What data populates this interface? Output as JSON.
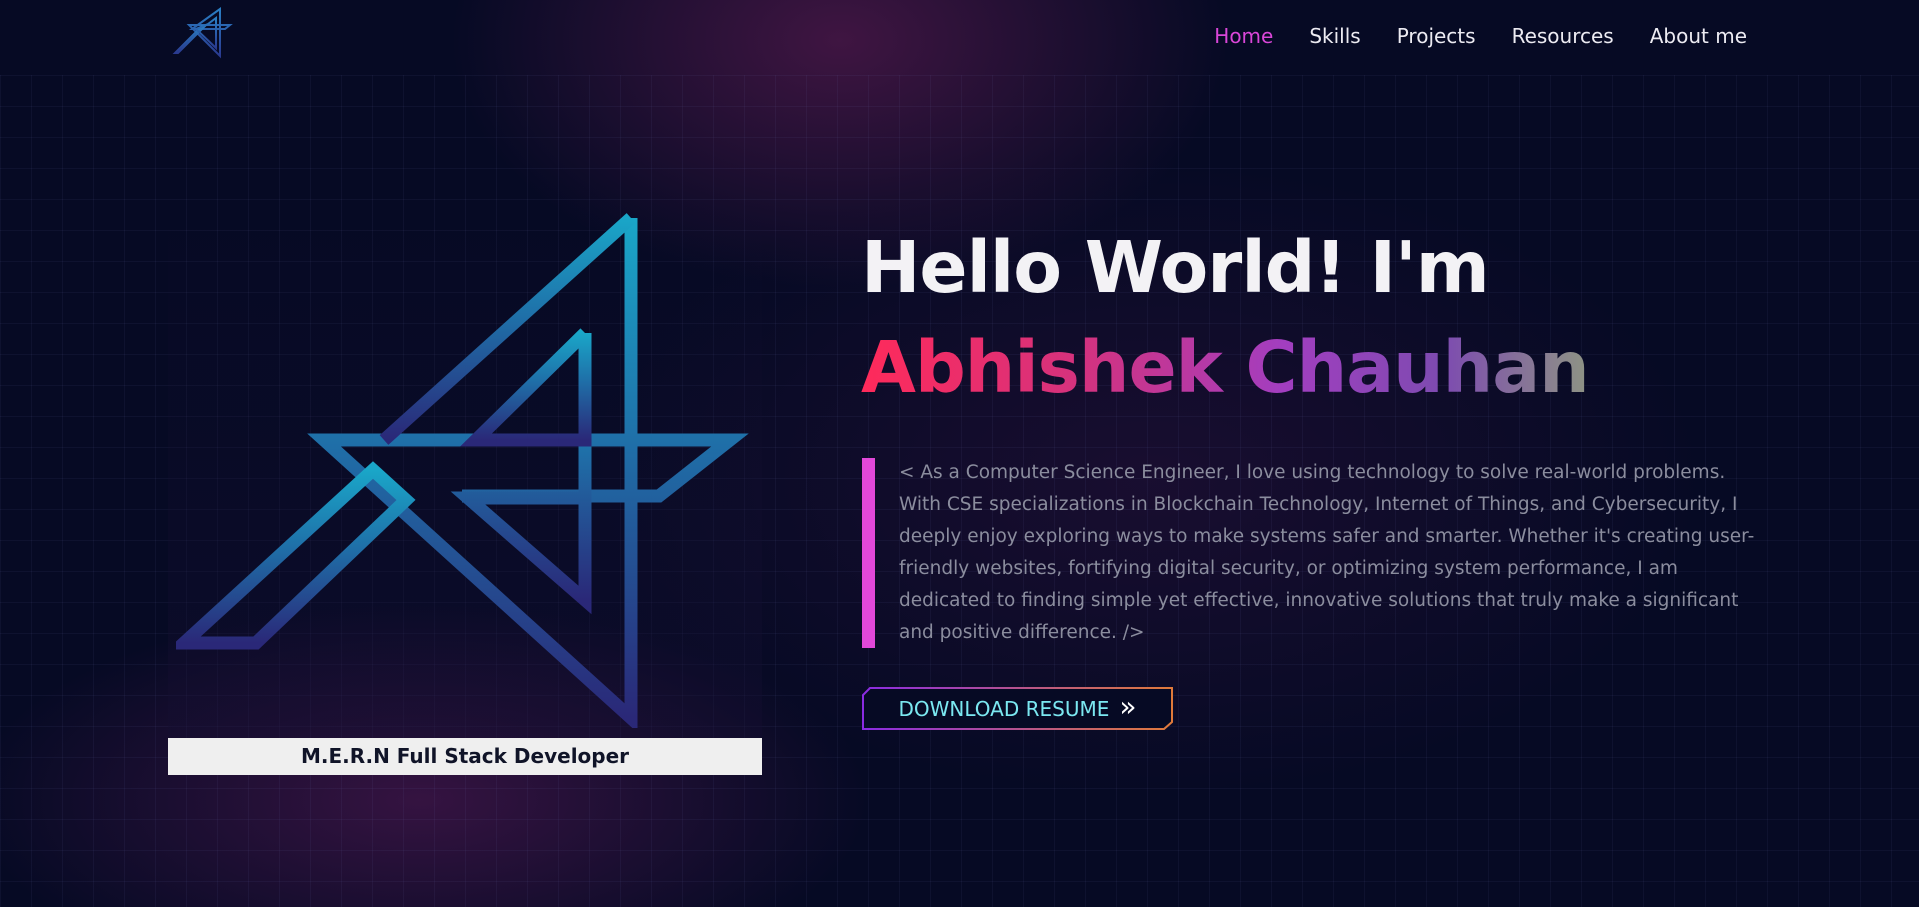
{
  "nav": {
    "logo_label": "A",
    "links": [
      {
        "label": "Home",
        "active": true
      },
      {
        "label": "Skills",
        "active": false
      },
      {
        "label": "Projects",
        "active": false
      },
      {
        "label": "Resources",
        "active": false
      },
      {
        "label": "About me",
        "active": false
      }
    ]
  },
  "hero": {
    "greeting": "Hello World! I'm",
    "name": "Abhishek Chauhan",
    "role": "M.E.R.N Full Stack Developer",
    "bio": "< As a Computer Science Engineer, I love using technology to solve real-world problems. With CSE specializations in Blockchain Technology, Internet of Things, and Cybersecurity, I deeply enjoy exploring ways to make systems safer and smarter. Whether it's creating user-friendly websites, fortifying digital security, or optimizing system performance, I am dedicated to finding simple yet effective, innovative solutions that truly make a significant and positive difference. />",
    "resume_button": "DOWNLOAD RESUME",
    "resume_icon": "double-chevron-right-icon"
  },
  "colors": {
    "background": "#060a24",
    "accent_pink": "#d946d8",
    "name_gradient": [
      "#ff2a5a",
      "#a23ec0",
      "#8e9484"
    ],
    "logo_gradient": [
      "#1d9bc0",
      "#2a2a78"
    ],
    "button_text": "#7be8f1"
  }
}
